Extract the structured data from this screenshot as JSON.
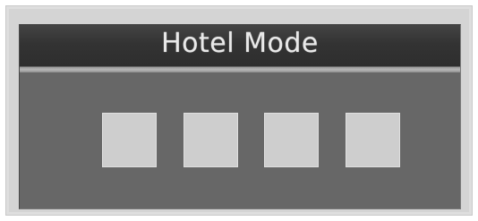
{
  "dialog": {
    "title": "Hotel Mode"
  },
  "indicators": [
    {
      "name": "indicator-1"
    },
    {
      "name": "indicator-2"
    },
    {
      "name": "indicator-3"
    },
    {
      "name": "indicator-4"
    }
  ],
  "colors": {
    "panel": "#676767",
    "title_bar": "#333333",
    "title_text": "#e9e9e9",
    "indicator": "#cecece",
    "frame": "#d4d4d4"
  }
}
